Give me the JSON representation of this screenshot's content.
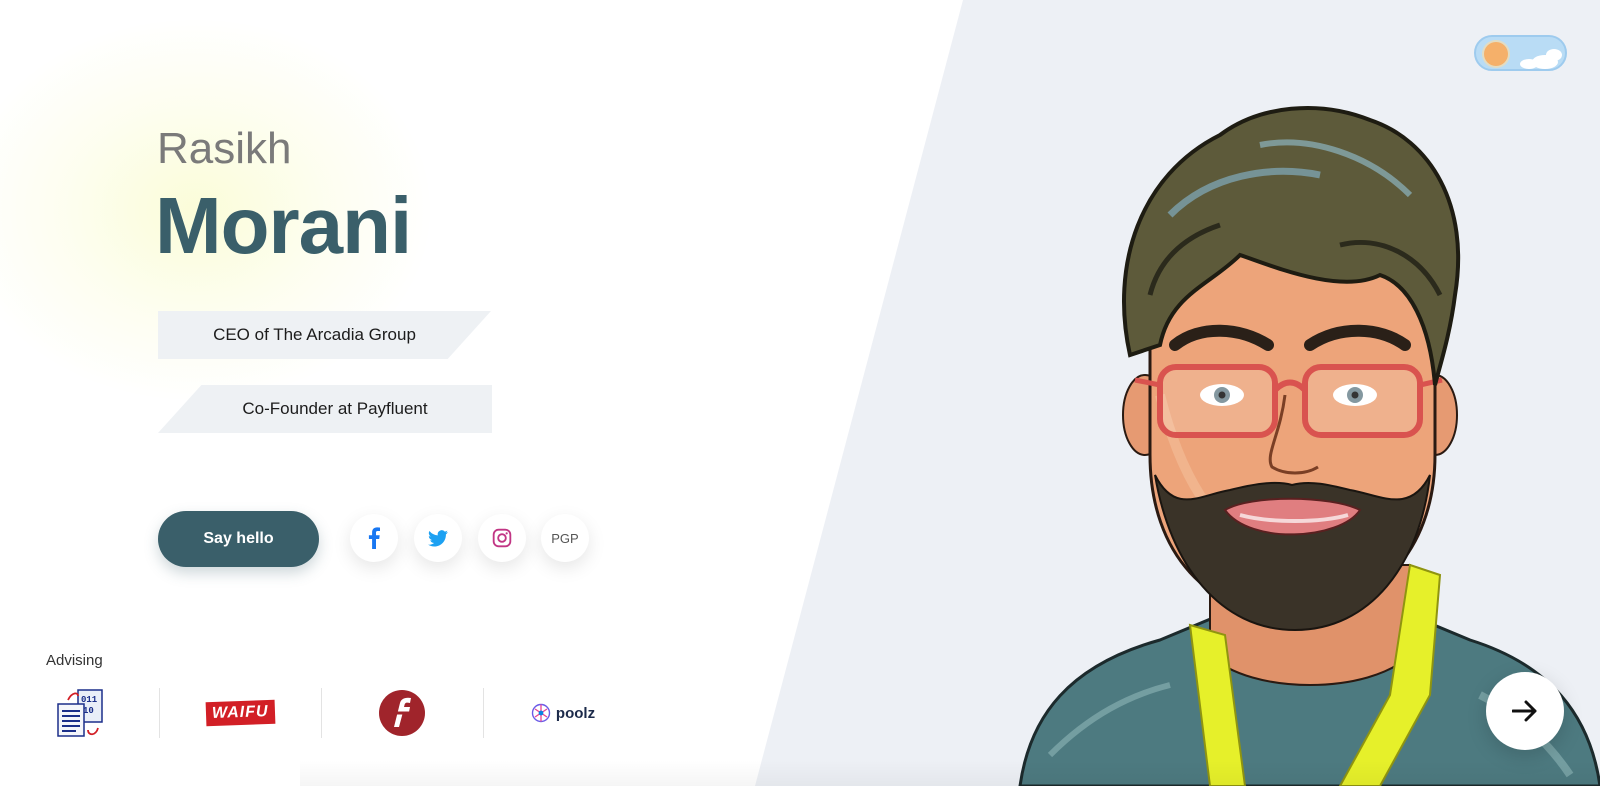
{
  "profile": {
    "first_name": "Rasikh",
    "last_name": "Morani"
  },
  "roles": [
    {
      "label": "CEO of The Arcadia Group"
    },
    {
      "label": "Co-Founder at Payfluent"
    }
  ],
  "cta": {
    "say_hello_label": "Say hello"
  },
  "social": {
    "pgp_label": "PGP",
    "icons": [
      "facebook-icon",
      "twitter-icon",
      "instagram-icon"
    ]
  },
  "advising": {
    "label": "Advising",
    "logos": [
      {
        "name": "binary-document-logo"
      },
      {
        "name": "waifu-logo",
        "text": "WAIFU"
      },
      {
        "name": "f-circle-logo"
      },
      {
        "name": "poolz-logo",
        "text": "poolz"
      }
    ]
  },
  "theme_toggle": {
    "mode": "day"
  },
  "colors": {
    "accent": "#3a5f6a",
    "panel": "#edf0f5",
    "role_bg": "#eef1f4",
    "facebook": "#1877f2",
    "twitter": "#1da1f2",
    "instagram": "#c13584"
  }
}
